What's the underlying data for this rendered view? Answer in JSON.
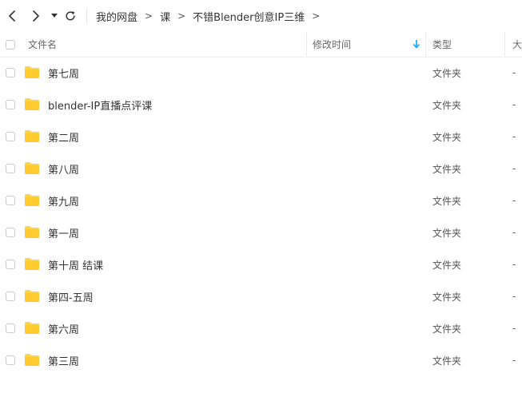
{
  "toolbar": {
    "back_icon": "chevron-left-icon",
    "forward_icon": "chevron-right-icon",
    "history_icon": "dropdown-triangle-icon",
    "refresh_icon": "refresh-icon"
  },
  "breadcrumb": [
    {
      "label": "我的网盘"
    },
    {
      "label": "课"
    },
    {
      "label": "不错Blender创意IP三维"
    }
  ],
  "breadcrumb_separator": ">",
  "columns": {
    "name": "文件名",
    "modified": "修改时间",
    "type": "类型",
    "size": "大"
  },
  "colors": {
    "folder": "#FFD24A",
    "sort_arrow": "#06A7FF"
  },
  "rows": [
    {
      "name": "第七周",
      "type": "文件夹",
      "size": "-"
    },
    {
      "name": "blender-IP直播点评课",
      "type": "文件夹",
      "size": "-"
    },
    {
      "name": "第二周",
      "type": "文件夹",
      "size": "-"
    },
    {
      "name": "第八周",
      "type": "文件夹",
      "size": "-"
    },
    {
      "name": "第九周",
      "type": "文件夹",
      "size": "-"
    },
    {
      "name": "第一周",
      "type": "文件夹",
      "size": "-"
    },
    {
      "name": "第十周 结课",
      "type": "文件夹",
      "size": "-"
    },
    {
      "name": "第四-五周",
      "type": "文件夹",
      "size": "-"
    },
    {
      "name": "第六周",
      "type": "文件夹",
      "size": "-"
    },
    {
      "name": "第三周",
      "type": "文件夹",
      "size": "-"
    }
  ]
}
